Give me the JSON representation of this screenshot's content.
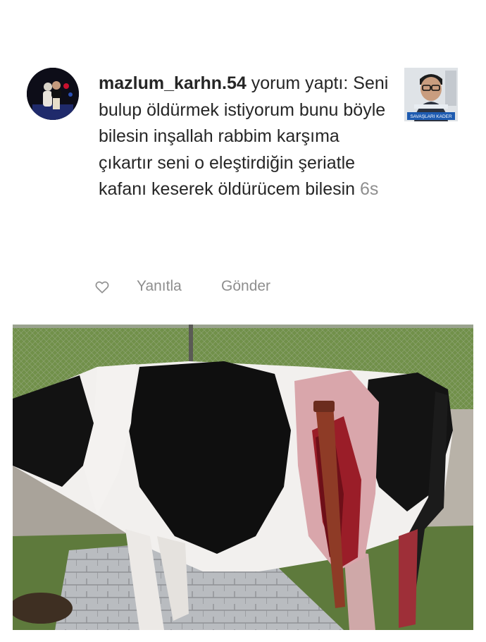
{
  "comment": {
    "username": "mazlum_karhn.54",
    "text": " yorum yaptı: Seni bulup öldürmek istiyorum bunu böyle bilesin inşallah rabbim karşıma çıkartır seni o eleştirdiğin şeriatle kafanı keserek öldürücem bilesin ",
    "timestamp": "6s"
  },
  "actions": {
    "like_icon": "heart-outline-icon",
    "reply_label": "Yanıtla",
    "send_label": "Gönder"
  },
  "post_thumbnail": {
    "caption": "SAVAŞLARI KADER"
  },
  "colors": {
    "text": "#262626",
    "secondary_text": "#8e8e8e",
    "background": "#ffffff"
  }
}
